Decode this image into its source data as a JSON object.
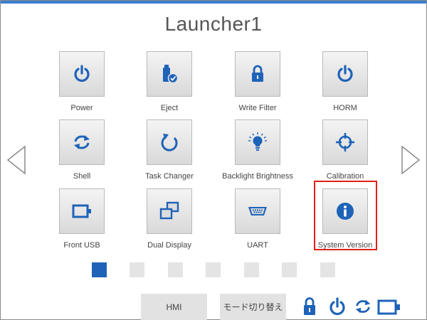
{
  "window": {
    "title": "Launcher1"
  },
  "tiles": [
    {
      "label": "Power",
      "icon": "power-icon"
    },
    {
      "label": "Eject",
      "icon": "usb-eject-icon"
    },
    {
      "label": "Write Filter",
      "icon": "lock-icon"
    },
    {
      "label": "HORM",
      "icon": "power-icon"
    },
    {
      "label": "Shell",
      "icon": "refresh-icon"
    },
    {
      "label": "Task Changer",
      "icon": "rotate-icon"
    },
    {
      "label": "Backlight Brightness",
      "icon": "lightbulb-icon"
    },
    {
      "label": "Calibration",
      "icon": "crosshair-icon"
    },
    {
      "label": "Front USB",
      "icon": "usb-port-icon"
    },
    {
      "label": "Dual Display",
      "icon": "dual-display-icon"
    },
    {
      "label": "UART",
      "icon": "serial-port-icon"
    },
    {
      "label": "System Version",
      "icon": "info-icon"
    }
  ],
  "pagination": {
    "pages": 7,
    "current": 1
  },
  "footer": {
    "hmi_label": "HMI",
    "mode_label": "モード切り替え",
    "status_icons": [
      "lock-icon",
      "power-icon",
      "refresh-icon",
      "usb-port-icon"
    ]
  },
  "colors": {
    "accent": "#1e63b8",
    "highlight": "#e0201b",
    "tile_gradient_top": "#f4f4f4",
    "tile_gradient_bottom": "#d9d9d9"
  }
}
